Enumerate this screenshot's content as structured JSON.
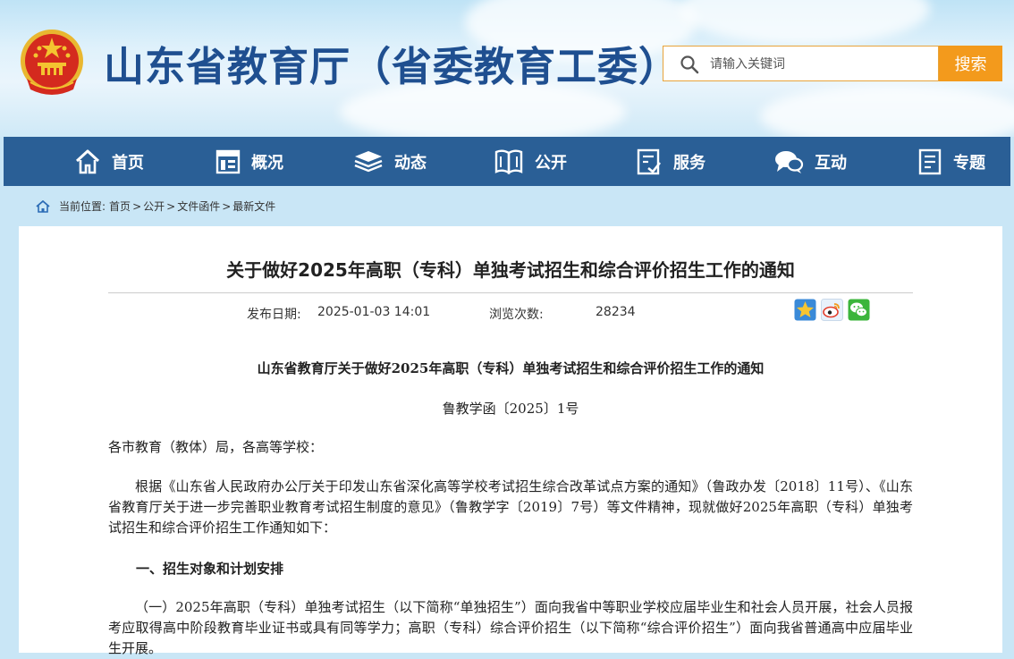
{
  "header": {
    "site_title": "山东省教育厅（省委教育工委）",
    "search": {
      "placeholder": "请输入关键词",
      "button_label": "搜索"
    }
  },
  "nav": {
    "items": [
      {
        "label": "首页",
        "icon": "home-icon"
      },
      {
        "label": "概况",
        "icon": "overview-icon"
      },
      {
        "label": "动态",
        "icon": "news-icon"
      },
      {
        "label": "公开",
        "icon": "book-icon"
      },
      {
        "label": "服务",
        "icon": "service-icon"
      },
      {
        "label": "互动",
        "icon": "chat-icon"
      },
      {
        "label": "专题",
        "icon": "topic-icon"
      }
    ]
  },
  "breadcrumb": {
    "prefix": "当前位置:",
    "items": [
      "首页",
      "公开",
      "文件函件",
      "最新文件"
    ],
    "separator": ">"
  },
  "article": {
    "title": "关于做好2025年高职（专科）单独考试招生和综合评价招生工作的通知",
    "publish_label": "发布日期:",
    "publish_date": "2025-01-03 14:01",
    "views_label": "浏览次数:",
    "views": "28234",
    "share": [
      "favorite-icon",
      "weibo-icon",
      "wechat-icon"
    ],
    "doc_title": "山东省教育厅关于做好2025年高职（专科）单独考试招生和综合评价招生工作的通知",
    "doc_number": "鲁教学函〔2025〕1号",
    "salutation": "各市教育（教体）局，各高等学校：",
    "para1": "根据《山东省人民政府办公厅关于印发山东省深化高等学校考试招生综合改革试点方案的通知》（鲁政办发〔2018〕11号）、《山东省教育厅关于进一步完善职业教育考试招生制度的意见》（鲁教学字〔2019〕7号）等文件精神，现就做好2025年高职（专科）单独考试招生和综合评价招生工作通知如下：",
    "section1_heading": "一、招生对象和计划安排",
    "para2": "（一）2025年高职（专科）单独考试招生（以下简称“单独招生”）面向我省中等职业学校应届毕业生和社会人员开展，社会人员报考应取得高中阶段教育毕业证书或具有同等学力；高职（专科）综合评价招生（以下简称“综合评价招生”）面向我省普通高中应届毕业生开展。"
  },
  "colors": {
    "nav_bg": "#2a5f96",
    "title_blue": "#1f4f90",
    "accent_orange": "#f39a1c"
  }
}
